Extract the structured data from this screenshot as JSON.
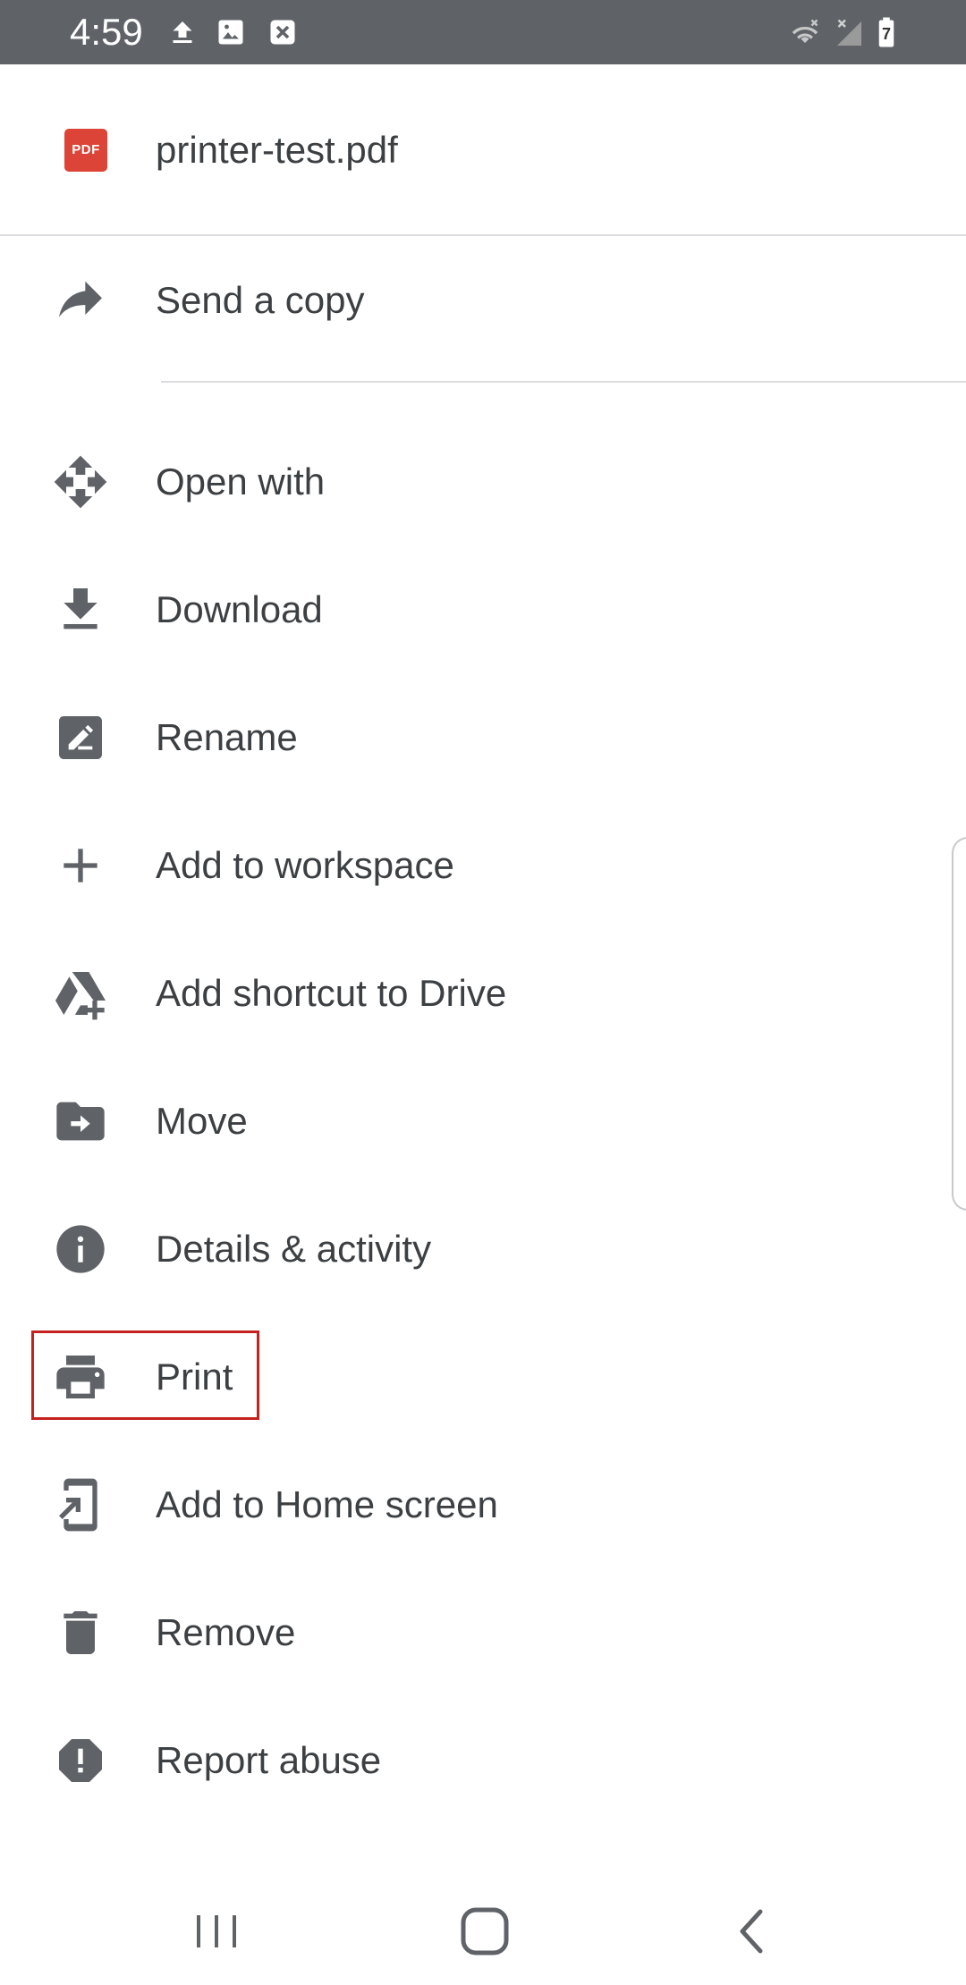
{
  "status_bar": {
    "time": "4:59",
    "left_icons": [
      "upload-icon",
      "image-icon",
      "app-notification-icon"
    ],
    "right_icons": [
      "wifi-icon",
      "no-signal-icon",
      "battery-icon"
    ],
    "battery_label": "7"
  },
  "header": {
    "file_type_label": "PDF",
    "file_name": "printer-test.pdf"
  },
  "menu": {
    "send_copy": "Send a copy",
    "items": [
      "Open with",
      "Download",
      "Rename",
      "Add to workspace",
      "Add shortcut to Drive",
      "Move",
      "Details & activity",
      "Print",
      "Add to Home screen",
      "Remove",
      "Report abuse"
    ]
  },
  "colors": {
    "status_bar": "#5f6368",
    "icon": "#5f6368",
    "text": "#3c4043",
    "pdf_red": "#db4437",
    "highlight": "#c5221f"
  },
  "nav_bar": [
    "recents-button",
    "home-button",
    "back-button"
  ]
}
